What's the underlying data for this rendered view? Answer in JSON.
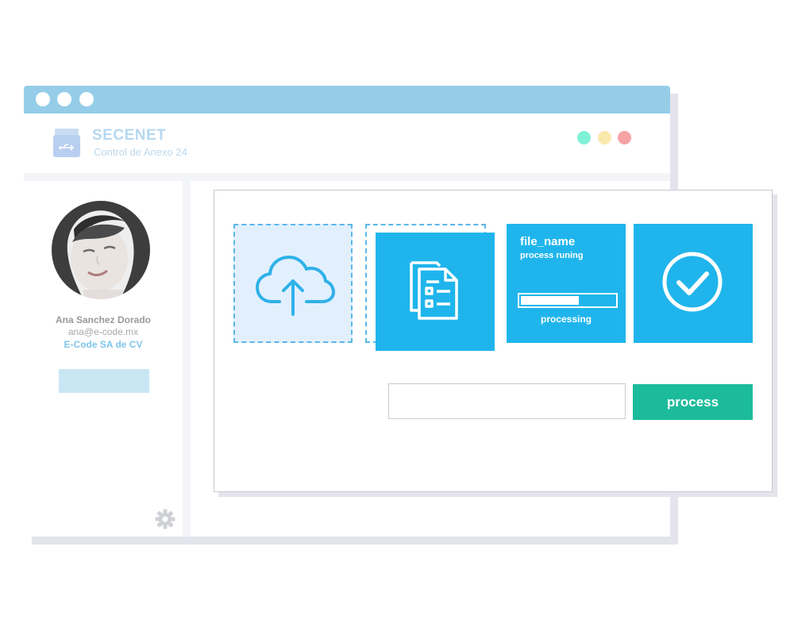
{
  "window": {
    "titlebar_color": "#95cde8",
    "titlebar_dot_count": 3
  },
  "app": {
    "brand": "SECENET",
    "subtitle": "Control de Anexo 24",
    "logo_icon": "usb-drive-icon",
    "status_dots": [
      "#7ff1d7",
      "#fbe8ac",
      "#f5a3a5"
    ]
  },
  "user": {
    "name": "Ana Sanchez Dorado",
    "email": "ana@e-code.mx",
    "company": "E-Code SA de CV",
    "avatar_icon": "user-photo"
  },
  "sidebar": {
    "settings_icon": "gear-icon"
  },
  "upload": {
    "icon": "cloud-upload-icon",
    "file_icon": "document-list-icon",
    "file_name": "file_name",
    "status": "process runing",
    "progress_label": "processing",
    "progress": 0.62,
    "done_icon": "check-circle-icon"
  },
  "form": {
    "input_value": "",
    "button_label": "process"
  },
  "colors": {
    "accent": "#1fb5ec",
    "drop_zone_bg": "#e2f0fd",
    "process_button": "#1cbb9b",
    "company_text": "#7fc4ea"
  }
}
